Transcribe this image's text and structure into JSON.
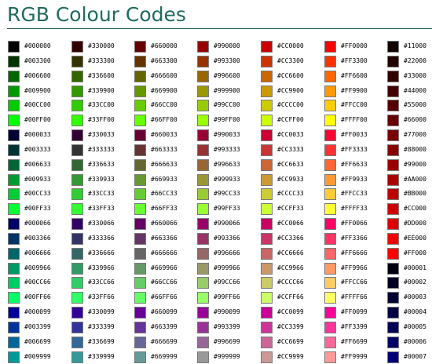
{
  "page": {
    "title": "RGB Colour Codes",
    "title_color": "#1f6b5f",
    "rule_color": "#2d5c55"
  },
  "columns": [
    {
      "items": [
        {
          "code": "#000000",
          "color": "#000000"
        },
        {
          "code": "#003300",
          "color": "#003300"
        },
        {
          "code": "#006600",
          "color": "#006600"
        },
        {
          "code": "#009900",
          "color": "#009900"
        },
        {
          "code": "#00CC00",
          "color": "#00CC00"
        },
        {
          "code": "#00FF00",
          "color": "#00FF00"
        },
        {
          "code": "#000033",
          "color": "#000033"
        },
        {
          "code": "#003333",
          "color": "#003333"
        },
        {
          "code": "#006633",
          "color": "#006633"
        },
        {
          "code": "#009933",
          "color": "#009933"
        },
        {
          "code": "#00CC33",
          "color": "#00CC33"
        },
        {
          "code": "#00FF33",
          "color": "#00FF33"
        },
        {
          "code": "#000066",
          "color": "#000066"
        },
        {
          "code": "#003366",
          "color": "#003366"
        },
        {
          "code": "#006666",
          "color": "#006666"
        },
        {
          "code": "#009966",
          "color": "#009966"
        },
        {
          "code": "#00CC66",
          "color": "#00CC66"
        },
        {
          "code": "#00FF66",
          "color": "#00FF66"
        },
        {
          "code": "#000099",
          "color": "#000099"
        },
        {
          "code": "#003399",
          "color": "#003399"
        },
        {
          "code": "#006699",
          "color": "#006699"
        },
        {
          "code": "#009999",
          "color": "#009999"
        }
      ]
    },
    {
      "items": [
        {
          "code": "#330000",
          "color": "#330000"
        },
        {
          "code": "#333300",
          "color": "#333300"
        },
        {
          "code": "#336600",
          "color": "#336600"
        },
        {
          "code": "#339900",
          "color": "#339900"
        },
        {
          "code": "#33CC00",
          "color": "#33CC00"
        },
        {
          "code": "#33FF00",
          "color": "#33FF00"
        },
        {
          "code": "#330033",
          "color": "#330033"
        },
        {
          "code": "#333333",
          "color": "#333333"
        },
        {
          "code": "#336633",
          "color": "#336633"
        },
        {
          "code": "#339933",
          "color": "#339933"
        },
        {
          "code": "#33CC33",
          "color": "#33CC33"
        },
        {
          "code": "#33FF33",
          "color": "#33FF33"
        },
        {
          "code": "#330066",
          "color": "#330066"
        },
        {
          "code": "#333366",
          "color": "#333366"
        },
        {
          "code": "#336666",
          "color": "#336666"
        },
        {
          "code": "#339966",
          "color": "#339966"
        },
        {
          "code": "#33CC66",
          "color": "#33CC66"
        },
        {
          "code": "#33FF66",
          "color": "#33FF66"
        },
        {
          "code": "#330099",
          "color": "#330099"
        },
        {
          "code": "#333399",
          "color": "#333399"
        },
        {
          "code": "#336699",
          "color": "#336699"
        },
        {
          "code": "#339999",
          "color": "#339999"
        }
      ]
    },
    {
      "items": [
        {
          "code": "#660000",
          "color": "#660000"
        },
        {
          "code": "#663300",
          "color": "#663300"
        },
        {
          "code": "#666600",
          "color": "#666600"
        },
        {
          "code": "#669900",
          "color": "#669900"
        },
        {
          "code": "#66CC00",
          "color": "#66CC00"
        },
        {
          "code": "#66FF00",
          "color": "#66FF00"
        },
        {
          "code": "#660033",
          "color": "#660033"
        },
        {
          "code": "#663333",
          "color": "#663333"
        },
        {
          "code": "#666633",
          "color": "#666633"
        },
        {
          "code": "#669933",
          "color": "#669933"
        },
        {
          "code": "#66CC33",
          "color": "#66CC33"
        },
        {
          "code": "#66FF33",
          "color": "#66FF33"
        },
        {
          "code": "#660066",
          "color": "#660066"
        },
        {
          "code": "#663366",
          "color": "#663366"
        },
        {
          "code": "#666666",
          "color": "#666666"
        },
        {
          "code": "#669966",
          "color": "#669966"
        },
        {
          "code": "#66CC66",
          "color": "#66CC66"
        },
        {
          "code": "#66FF66",
          "color": "#66FF66"
        },
        {
          "code": "#660099",
          "color": "#660099"
        },
        {
          "code": "#663399",
          "color": "#663399"
        },
        {
          "code": "#666699",
          "color": "#666699"
        },
        {
          "code": "#669999",
          "color": "#669999"
        }
      ]
    },
    {
      "items": [
        {
          "code": "#990000",
          "color": "#990000"
        },
        {
          "code": "#993300",
          "color": "#993300"
        },
        {
          "code": "#996600",
          "color": "#996600"
        },
        {
          "code": "#999900",
          "color": "#999900"
        },
        {
          "code": "#99CC00",
          "color": "#99CC00"
        },
        {
          "code": "#99FF00",
          "color": "#99FF00"
        },
        {
          "code": "#990033",
          "color": "#990033"
        },
        {
          "code": "#993333",
          "color": "#993333"
        },
        {
          "code": "#996633",
          "color": "#996633"
        },
        {
          "code": "#999933",
          "color": "#999933"
        },
        {
          "code": "#99CC33",
          "color": "#99CC33"
        },
        {
          "code": "#99FF33",
          "color": "#99FF33"
        },
        {
          "code": "#990066",
          "color": "#990066"
        },
        {
          "code": "#993366",
          "color": "#993366"
        },
        {
          "code": "#996666",
          "color": "#996666"
        },
        {
          "code": "#999966",
          "color": "#999966"
        },
        {
          "code": "#99CC66",
          "color": "#99CC66"
        },
        {
          "code": "#99FF66",
          "color": "#99FF66"
        },
        {
          "code": "#990099",
          "color": "#990099"
        },
        {
          "code": "#993399",
          "color": "#993399"
        },
        {
          "code": "#996699",
          "color": "#996699"
        },
        {
          "code": "#999999",
          "color": "#999999"
        }
      ]
    },
    {
      "items": [
        {
          "code": "#CC0000",
          "color": "#CC0000"
        },
        {
          "code": "#CC3300",
          "color": "#CC3300"
        },
        {
          "code": "#CC6600",
          "color": "#CC6600"
        },
        {
          "code": "#CC9900",
          "color": "#CC9900"
        },
        {
          "code": "#CCCC00",
          "color": "#CCCC00"
        },
        {
          "code": "#CCFF00",
          "color": "#CCFF00"
        },
        {
          "code": "#CC0033",
          "color": "#CC0033"
        },
        {
          "code": "#CC3333",
          "color": "#CC3333"
        },
        {
          "code": "#CC6633",
          "color": "#CC6633"
        },
        {
          "code": "#CC9933",
          "color": "#CC9933"
        },
        {
          "code": "#CCCC33",
          "color": "#CCCC33"
        },
        {
          "code": "#CCFF33",
          "color": "#CCFF33"
        },
        {
          "code": "#CC0066",
          "color": "#CC0066"
        },
        {
          "code": "#CC3366",
          "color": "#CC3366"
        },
        {
          "code": "#CC6666",
          "color": "#CC6666"
        },
        {
          "code": "#CC9966",
          "color": "#CC9966"
        },
        {
          "code": "#CCCC66",
          "color": "#CCCC66"
        },
        {
          "code": "#CCFF66",
          "color": "#CCFF66"
        },
        {
          "code": "#CC0099",
          "color": "#CC0099"
        },
        {
          "code": "#CC3399",
          "color": "#CC3399"
        },
        {
          "code": "#CC6699",
          "color": "#CC6699"
        },
        {
          "code": "#CC9999",
          "color": "#CC9999"
        }
      ]
    },
    {
      "items": [
        {
          "code": "#FF0000",
          "color": "#FF0000"
        },
        {
          "code": "#FF3300",
          "color": "#FF3300"
        },
        {
          "code": "#FF6600",
          "color": "#FF6600"
        },
        {
          "code": "#FF9900",
          "color": "#FF9900"
        },
        {
          "code": "#FFCC00",
          "color": "#FFCC00"
        },
        {
          "code": "#FFFF00",
          "color": "#FFFF00"
        },
        {
          "code": "#FF0033",
          "color": "#FF0033"
        },
        {
          "code": "#FF3333",
          "color": "#FF3333"
        },
        {
          "code": "#FF6633",
          "color": "#FF6633"
        },
        {
          "code": "#FF9933",
          "color": "#FF9933"
        },
        {
          "code": "#FFCC33",
          "color": "#FFCC33"
        },
        {
          "code": "#FFFF33",
          "color": "#FFFF33"
        },
        {
          "code": "#FF0066",
          "color": "#FF0066"
        },
        {
          "code": "#FF3366",
          "color": "#FF3366"
        },
        {
          "code": "#FF6666",
          "color": "#FF6666"
        },
        {
          "code": "#FF9966",
          "color": "#FF9966"
        },
        {
          "code": "#FFCC66",
          "color": "#FFCC66"
        },
        {
          "code": "#FFFF66",
          "color": "#FFFF66"
        },
        {
          "code": "#FF0099",
          "color": "#FF0099"
        },
        {
          "code": "#FF3399",
          "color": "#FF3399"
        },
        {
          "code": "#FF6699",
          "color": "#FF6699"
        },
        {
          "code": "#FF9999",
          "color": "#FF9999"
        }
      ]
    },
    {
      "items": [
        {
          "code": "#11000",
          "color": "#110000"
        },
        {
          "code": "#22000",
          "color": "#220000"
        },
        {
          "code": "#33000",
          "color": "#330000"
        },
        {
          "code": "#44000",
          "color": "#440000"
        },
        {
          "code": "#55000",
          "color": "#550000"
        },
        {
          "code": "#66000",
          "color": "#660000"
        },
        {
          "code": "#77000",
          "color": "#770000"
        },
        {
          "code": "#88000",
          "color": "#880000"
        },
        {
          "code": "#99000",
          "color": "#990000"
        },
        {
          "code": "#AA000",
          "color": "#AA0000"
        },
        {
          "code": "#BB000",
          "color": "#BB0000"
        },
        {
          "code": "#CC000",
          "color": "#CC0000"
        },
        {
          "code": "#DD000",
          "color": "#DD0000"
        },
        {
          "code": "#EE000",
          "color": "#EE0000"
        },
        {
          "code": "#FF000",
          "color": "#FF0000"
        },
        {
          "code": "#00001",
          "color": "#000011"
        },
        {
          "code": "#00002",
          "color": "#000022"
        },
        {
          "code": "#00003",
          "color": "#000033"
        },
        {
          "code": "#00004",
          "color": "#000044"
        },
        {
          "code": "#00005",
          "color": "#000055"
        },
        {
          "code": "#00006",
          "color": "#000066"
        },
        {
          "code": "#00007",
          "color": "#000077"
        }
      ]
    }
  ]
}
